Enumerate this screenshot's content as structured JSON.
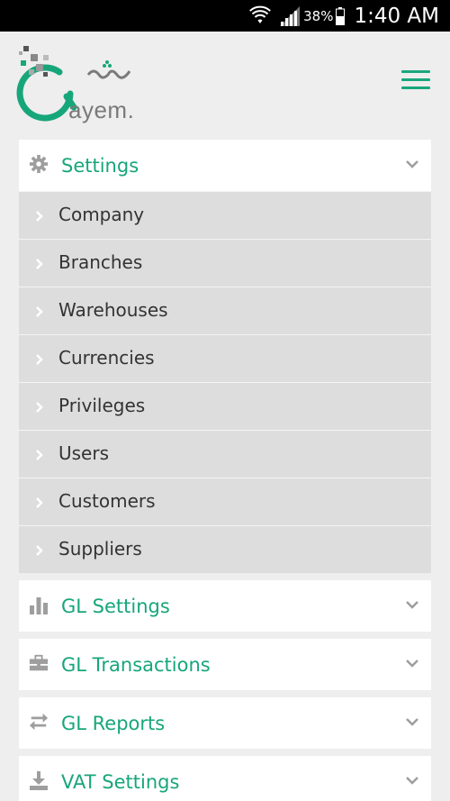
{
  "status_bar": {
    "battery_percent": "38%",
    "time": "1:40 AM"
  },
  "app": {
    "logo_text": "ayem."
  },
  "colors": {
    "accent": "#17a67a",
    "submenu_bg": "#dddddd",
    "icon_gray": "#9e9e9e"
  },
  "menu": {
    "settings": {
      "label": "Settings",
      "icon": "gear-icon",
      "expanded": true,
      "items": [
        {
          "label": "Company"
        },
        {
          "label": "Branches"
        },
        {
          "label": "Warehouses"
        },
        {
          "label": "Currencies"
        },
        {
          "label": "Privileges"
        },
        {
          "label": "Users"
        },
        {
          "label": "Customers"
        },
        {
          "label": "Suppliers"
        }
      ]
    },
    "gl_settings": {
      "label": "GL Settings",
      "icon": "bar-chart-icon"
    },
    "gl_transactions": {
      "label": "GL Transactions",
      "icon": "briefcase-icon"
    },
    "gl_reports": {
      "label": "GL Reports",
      "icon": "swap-arrows-icon"
    },
    "vat_settings": {
      "label": "VAT Settings",
      "icon": "download-icon"
    }
  }
}
